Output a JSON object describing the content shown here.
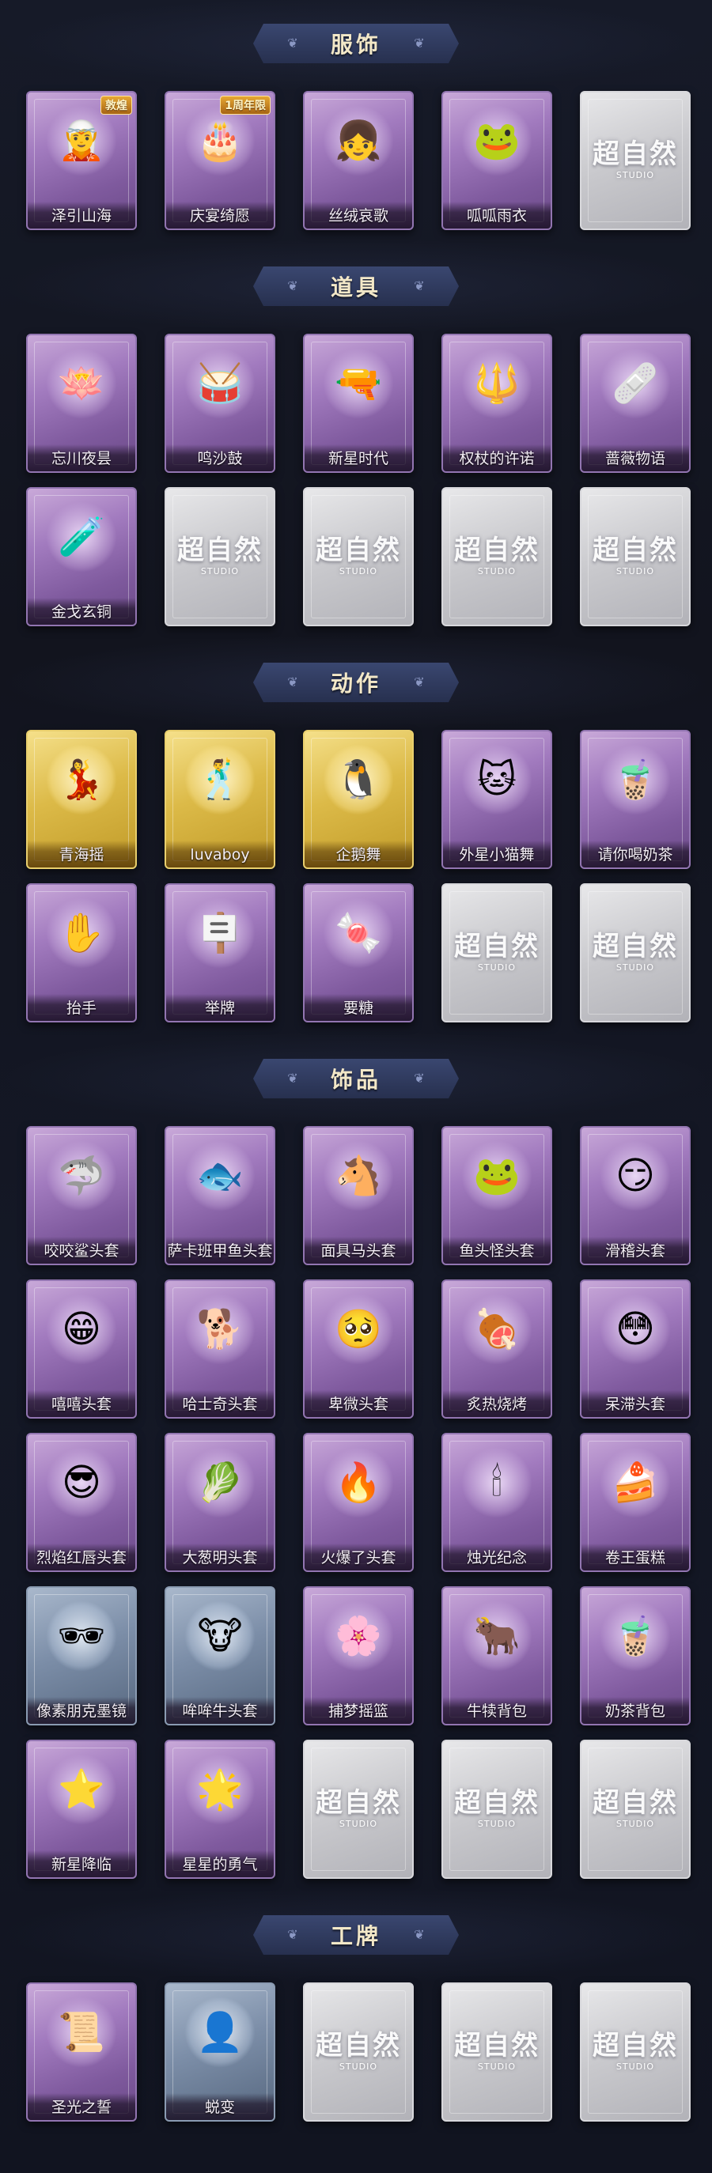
{
  "sections": [
    {
      "title": "服饰",
      "items": [
        {
          "label": "泽引山海",
          "style": "purple",
          "icon": "elf-character-icon",
          "glyph": "🧝",
          "badge": "敦煌"
        },
        {
          "label": "庆宴绮愿",
          "style": "purple",
          "icon": "girl-with-cake-icon",
          "glyph": "🎂",
          "badge": "1周年限"
        },
        {
          "label": "丝绒哀歌",
          "style": "purple",
          "icon": "gothic-girl-icon",
          "glyph": "👧"
        },
        {
          "label": "呱呱雨衣",
          "style": "purple",
          "icon": "frog-raincoat-icon",
          "glyph": "🐸"
        },
        {
          "label": "",
          "style": "empty",
          "icon": "empty-slot-icon"
        }
      ]
    },
    {
      "title": "道具",
      "items": [
        {
          "label": "忘川夜昙",
          "style": "purple",
          "icon": "lotus-icon",
          "glyph": "🪷"
        },
        {
          "label": "鸣沙鼓",
          "style": "purple",
          "icon": "drum-icon",
          "glyph": "🥁"
        },
        {
          "label": "新星时代",
          "style": "purple",
          "icon": "revolver-icon",
          "glyph": "🔫"
        },
        {
          "label": "权杖的许诺",
          "style": "purple",
          "icon": "scepter-icon",
          "glyph": "🔱"
        },
        {
          "label": "蔷薇物语",
          "style": "purple",
          "icon": "medkit-icon",
          "glyph": "🩹"
        },
        {
          "label": "金戈玄铜",
          "style": "purple",
          "icon": "bottle-icon",
          "glyph": "🧪"
        },
        {
          "label": "",
          "style": "empty",
          "icon": "empty-slot-icon"
        },
        {
          "label": "",
          "style": "empty",
          "icon": "empty-slot-icon"
        },
        {
          "label": "",
          "style": "empty",
          "icon": "empty-slot-icon"
        },
        {
          "label": "",
          "style": "empty",
          "icon": "empty-slot-icon"
        }
      ]
    },
    {
      "title": "动作",
      "items": [
        {
          "label": "青海摇",
          "style": "gold",
          "icon": "dance-pose-icon",
          "glyph": "💃"
        },
        {
          "label": "luvaboy",
          "style": "gold",
          "icon": "dance-pose-icon",
          "glyph": "🕺"
        },
        {
          "label": "企鹅舞",
          "style": "gold",
          "icon": "dance-pose-icon",
          "glyph": "🐧"
        },
        {
          "label": "外星小猫舞",
          "style": "purple",
          "icon": "dance-pose-icon",
          "glyph": "🐱"
        },
        {
          "label": "请你喝奶茶",
          "style": "purple",
          "icon": "sign-pose-icon",
          "glyph": "🧋"
        },
        {
          "label": "抬手",
          "style": "purple",
          "icon": "wave-pose-icon",
          "glyph": "✋"
        },
        {
          "label": "举牌",
          "style": "purple",
          "icon": "sign-pose-icon",
          "glyph": "🪧"
        },
        {
          "label": "要糖",
          "style": "purple",
          "icon": "beg-pose-icon",
          "glyph": "🍬"
        },
        {
          "label": "",
          "style": "empty",
          "icon": "empty-slot-icon"
        },
        {
          "label": "",
          "style": "empty",
          "icon": "empty-slot-icon"
        }
      ]
    },
    {
      "title": "饰品",
      "items": [
        {
          "label": "咬咬鲨头套",
          "style": "purple",
          "icon": "shark-head-icon",
          "glyph": "🦈"
        },
        {
          "label": "萨卡班甲鱼头套",
          "style": "purple",
          "icon": "fish-head-icon",
          "glyph": "🐟"
        },
        {
          "label": "面具马头套",
          "style": "purple",
          "icon": "horse-head-icon",
          "glyph": "🐴"
        },
        {
          "label": "鱼头怪头套",
          "style": "purple",
          "icon": "fishman-head-icon",
          "glyph": "🐸"
        },
        {
          "label": "滑稽头套",
          "style": "purple",
          "icon": "smirk-face-icon",
          "glyph": "😏"
        },
        {
          "label": "嘻嘻头套",
          "style": "purple",
          "icon": "grin-face-icon",
          "glyph": "😁"
        },
        {
          "label": "哈士奇头套",
          "style": "purple",
          "icon": "husky-head-icon",
          "glyph": "🐕"
        },
        {
          "label": "卑微头套",
          "style": "purple",
          "icon": "sad-face-icon",
          "glyph": "🥺"
        },
        {
          "label": "炙热烧烤",
          "style": "purple",
          "icon": "bbq-head-icon",
          "glyph": "🍖"
        },
        {
          "label": "呆滞头套",
          "style": "purple",
          "icon": "dazed-face-icon",
          "glyph": "😳"
        },
        {
          "label": "烈焰红唇头套",
          "style": "purple",
          "icon": "pikachu-head-icon",
          "glyph": "😎"
        },
        {
          "label": "大葱明头套",
          "style": "purple",
          "icon": "scallion-head-icon",
          "glyph": "🥬"
        },
        {
          "label": "火爆了头套",
          "style": "purple",
          "icon": "flame-head-icon",
          "glyph": "🔥"
        },
        {
          "label": "烛光纪念",
          "style": "purple",
          "icon": "candle-head-icon",
          "glyph": "🕯"
        },
        {
          "label": "卷王蛋糕",
          "style": "purple",
          "icon": "roll-cake-icon",
          "glyph": "🍰"
        },
        {
          "label": "像素朋克墨镜",
          "style": "blue",
          "icon": "pixel-sunglasses-icon",
          "glyph": "🕶"
        },
        {
          "label": "哞哞牛头套",
          "style": "blue",
          "icon": "cow-head-icon",
          "glyph": "🐮"
        },
        {
          "label": "捕梦摇篮",
          "style": "purple",
          "icon": "dreamcatcher-icon",
          "glyph": "🌸"
        },
        {
          "label": "牛犊背包",
          "style": "purple",
          "icon": "calf-backpack-icon",
          "glyph": "🐂"
        },
        {
          "label": "奶茶背包",
          "style": "purple",
          "icon": "milktea-backpack-icon",
          "glyph": "🧋"
        },
        {
          "label": "新星降临",
          "style": "purple",
          "icon": "charm-pendant-icon",
          "glyph": "⭐"
        },
        {
          "label": "星星的勇气",
          "style": "purple",
          "icon": "charm-pendant-icon",
          "glyph": "🌟"
        },
        {
          "label": "",
          "style": "empty",
          "icon": "empty-slot-icon"
        },
        {
          "label": "",
          "style": "empty",
          "icon": "empty-slot-icon"
        },
        {
          "label": "",
          "style": "empty",
          "icon": "empty-slot-icon"
        }
      ]
    },
    {
      "title": "工牌",
      "items": [
        {
          "label": "圣光之誓",
          "style": "purple",
          "icon": "ornate-card-icon",
          "glyph": "📜"
        },
        {
          "label": "蜕变",
          "style": "blue",
          "icon": "silhouette-card-icon",
          "glyph": "👤"
        },
        {
          "label": "",
          "style": "empty",
          "icon": "empty-slot-icon"
        },
        {
          "label": "",
          "style": "empty",
          "icon": "empty-slot-icon"
        },
        {
          "label": "",
          "style": "empty",
          "icon": "empty-slot-icon"
        }
      ]
    }
  ],
  "empty_slot": {
    "watermark": "超自然",
    "watermark_sub": "STUDIO"
  }
}
